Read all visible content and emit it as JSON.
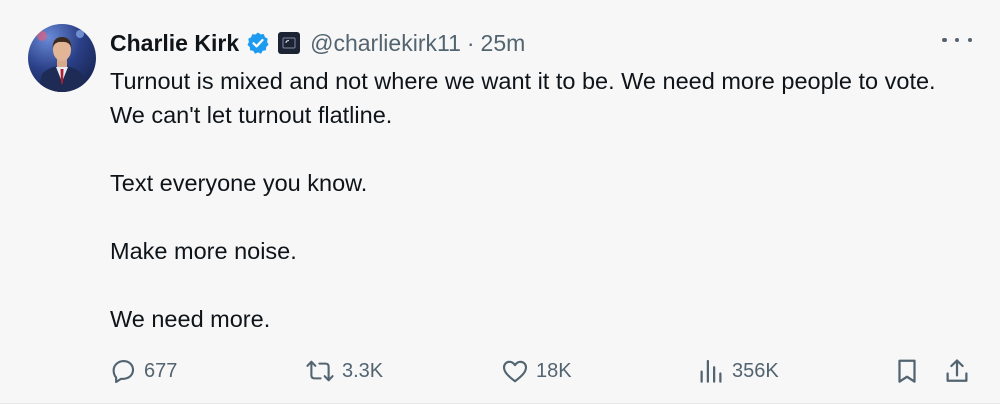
{
  "author": {
    "name": "Charlie Kirk",
    "handle": "@charliekirk11",
    "separator": "·",
    "time": "25m",
    "verified": true,
    "verified_color": "#1d9bf0"
  },
  "tweet": {
    "paragraphs": [
      "Turnout is mixed and not where we want it to be. We need more people to vote. We can't let turnout flatline.",
      "Text everyone you know.",
      "Make more noise.",
      "We need more."
    ]
  },
  "actions": {
    "reply": {
      "icon": "reply-icon",
      "count": "677"
    },
    "repost": {
      "icon": "repost-icon",
      "count": "3.3K"
    },
    "like": {
      "icon": "heart-icon",
      "count": "18K"
    },
    "views": {
      "icon": "views-icon",
      "count": "356K"
    },
    "bookmark": {
      "icon": "bookmark-icon"
    },
    "share": {
      "icon": "share-icon"
    }
  },
  "colors": {
    "background": "#f7f7f7",
    "text": "#0f1419",
    "secondary": "#536471"
  }
}
